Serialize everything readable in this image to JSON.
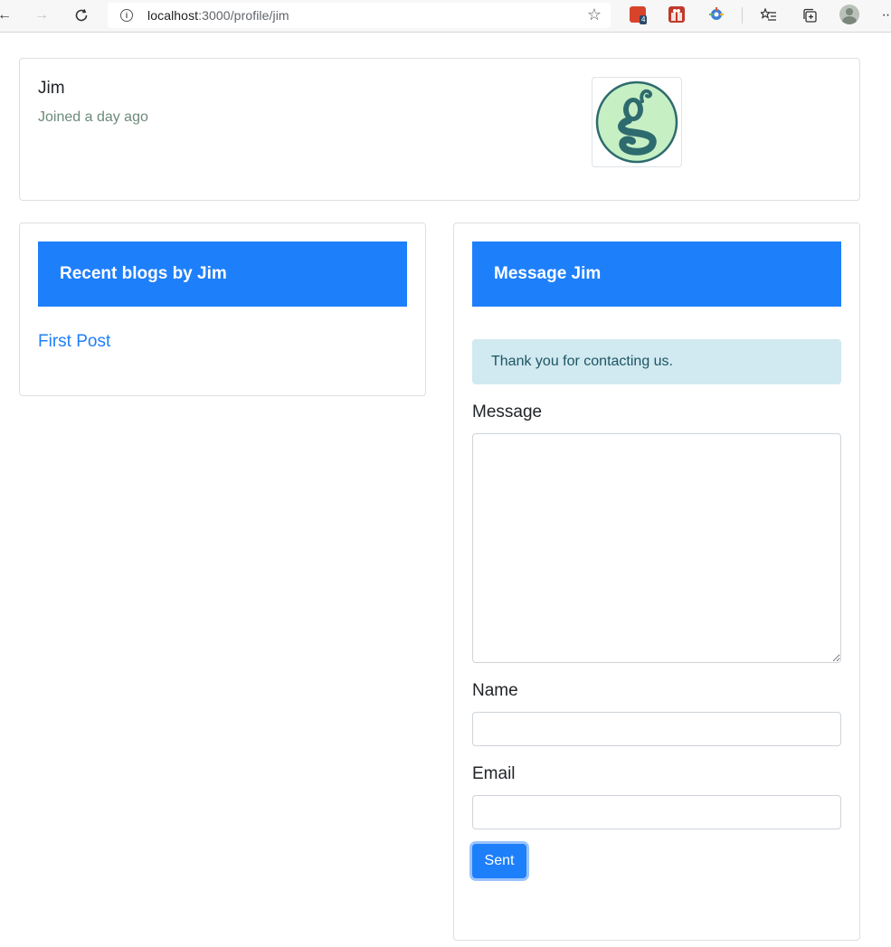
{
  "browser": {
    "url_host": "localhost",
    "url_path": ":3000/profile/jim",
    "extension_badge": "4",
    "icons": {
      "back": "arrow-left-icon",
      "forward": "arrow-right-icon",
      "reload": "reload-icon",
      "info": "info-icon",
      "favorite": "star-icon",
      "favorites_bar": "favorites-list-icon",
      "collections": "collections-icon",
      "more": "more-icon"
    }
  },
  "profile": {
    "name": "Jim",
    "joined": "Joined a day ago",
    "avatar_colors": {
      "fill": "#c6efc4",
      "stroke": "#2e6b6e",
      "glyph": "#2e6b6e"
    }
  },
  "blogs": {
    "header": "Recent blogs by Jim",
    "posts": [
      {
        "title": "First Post"
      }
    ]
  },
  "message": {
    "header": "Message Jim",
    "alert": "Thank you for contacting us.",
    "message_label": "Message",
    "message_value": "",
    "name_label": "Name",
    "name_value": "",
    "email_label": "Email",
    "email_value": "",
    "submit_label": "Sent"
  },
  "colors": {
    "primary": "#1e7ffb",
    "alert_bg": "#d1e9f0",
    "alert_text": "#1c5563",
    "muted_text": "#6c8b7a"
  }
}
